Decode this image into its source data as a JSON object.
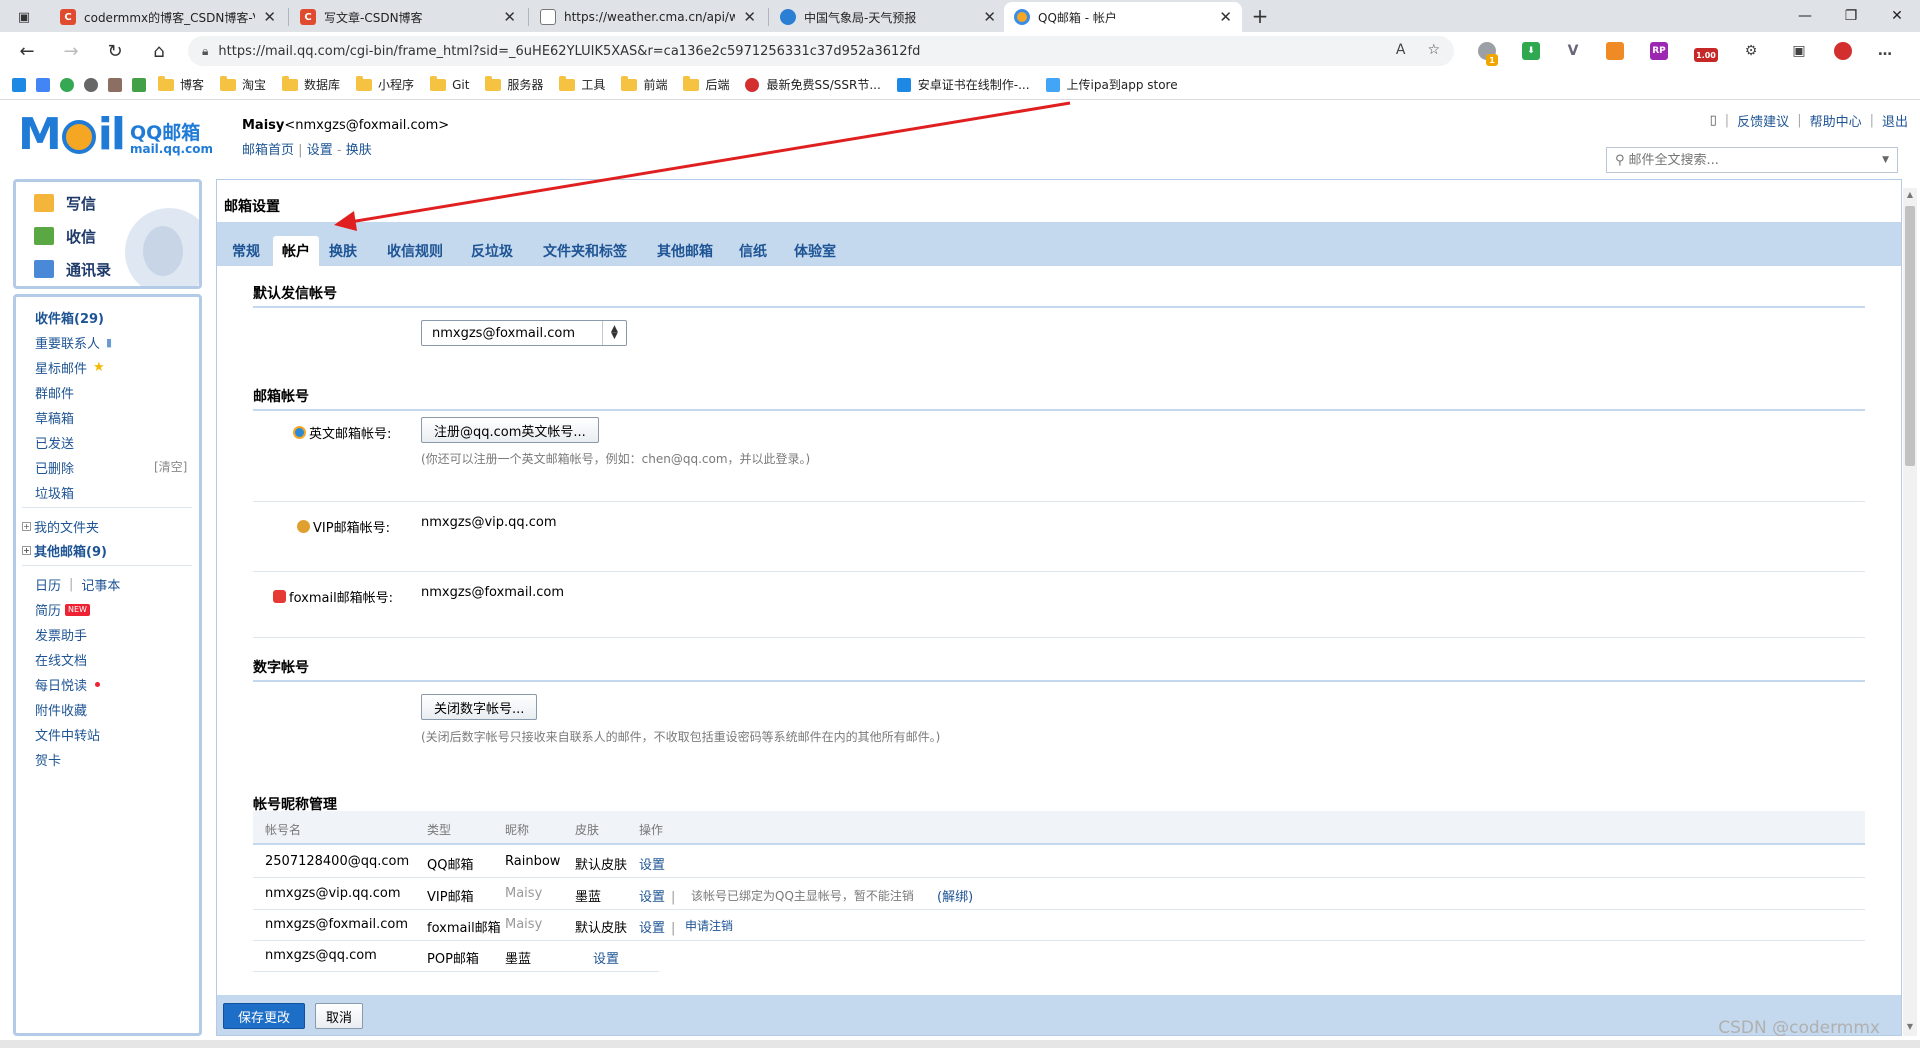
{
  "browser": {
    "tabs": [
      {
        "title": "codermmx的博客_CSDN博客-Vue",
        "icon": "csdn-icon",
        "color": "#e04a2f"
      },
      {
        "title": "写文章-CSDN博客",
        "icon": "csdn-icon",
        "color": "#e04a2f"
      },
      {
        "title": "https://weather.cma.cn/api/weat",
        "icon": "document-icon",
        "color": "#777777"
      },
      {
        "title": "中国气象局-天气预报",
        "icon": "weather-icon",
        "color": "#2a7fd4"
      },
      {
        "title": "QQ邮箱 - 帐户",
        "icon": "qqmail-icon",
        "color": "#f5a623"
      }
    ],
    "new_tab": "+",
    "url": "https://mail.qq.com/cgi-bin/frame_html?sid=_6uHE62YLUIK5XAS&r=ca136e2c5971256331c37d952a3612fd",
    "bookmarks": [
      "博客",
      "淘宝",
      "数据库",
      "小程序",
      "Git",
      "服务器",
      "工具",
      "前端",
      "后端",
      "最新免费SS/SSR节...",
      "安卓证书在线制作-...",
      "上传ipa到app store"
    ],
    "ext_badges": {
      "badge1": "1",
      "badge2": "1.00"
    }
  },
  "mail_header": {
    "logo_mail": "M",
    "logo_il": "il",
    "logo_cn": "QQ邮箱",
    "logo_domain": "mail.qq.com",
    "user_name": "Maisy",
    "user_email": "<nmxgzs@foxmail.com>",
    "links": [
      "邮箱首页",
      "设置",
      "换肤"
    ],
    "top_links": [
      "反馈建议",
      "帮助中心",
      "退出"
    ],
    "search_placeholder": "邮件全文搜索..."
  },
  "sidebar": {
    "quick": [
      "写信",
      "收信",
      "通讯录"
    ],
    "folders": [
      "收件箱(29)",
      "重要联系人",
      "星标邮件",
      "群邮件",
      "草稿箱",
      "已发送",
      "已删除",
      "垃圾箱"
    ],
    "clear_label": "[清空]",
    "my_folders": "我的文件夹",
    "other_mail": "其他邮箱(9)",
    "calendar": "日历",
    "notes": "记事本",
    "apps": [
      "简历",
      "发票助手",
      "在线文档",
      "每日悦读",
      "附件收藏",
      "文件中转站",
      "贺卡"
    ],
    "new_tag": "NEW"
  },
  "settings": {
    "page_title": "邮箱设置",
    "tabs": [
      "常规",
      "帐户",
      "换肤",
      "收信规则",
      "反垃圾",
      "文件夹和标签",
      "其他邮箱",
      "信纸",
      "体验室"
    ],
    "active_tab": "帐户",
    "default_sender_section": "默认发信帐号",
    "default_sender_value": "nmxgzs@foxmail.com",
    "mailbox_section": "邮箱帐号",
    "english_label": "英文邮箱帐号:",
    "english_button": "注册@qq.com英文帐号...",
    "english_hint": "(你还可以注册一个英文邮箱帐号，例如：chen@qq.com，并以此登录。)",
    "vip_label": "VIP邮箱帐号:",
    "vip_value": "nmxgzs@vip.qq.com",
    "foxmail_label": "foxmail邮箱帐号:",
    "foxmail_value": "nmxgzs@foxmail.com",
    "digital_section": "数字帐号",
    "digital_button": "关闭数字帐号...",
    "digital_hint": "(关闭后数字帐号只接收来自联系人的邮件，不收取包括重设密码等系统邮件在内的其他所有邮件。)",
    "nickname_section": "帐号昵称管理",
    "table_headers": [
      "帐号名",
      "类型",
      "昵称",
      "皮肤",
      "操作"
    ],
    "rows": [
      {
        "account": "2507128400@qq.com",
        "type": "QQ邮箱",
        "nickname": "Rainbow",
        "skin": "默认皮肤",
        "op": "设置",
        "extra": ""
      },
      {
        "account": "nmxgzs@vip.qq.com",
        "type": "VIP邮箱",
        "nickname": "Maisy",
        "skin": "墨蓝",
        "op": "设置",
        "extra": "该帐号已绑定为QQ主显帐号，暂不能注销",
        "extra_link": "(解绑)"
      },
      {
        "account": "nmxgzs@foxmail.com",
        "type": "foxmail邮箱",
        "nickname": "Maisy",
        "skin": "默认皮肤",
        "op": "设置",
        "extra": "",
        "extra_link": "申请注销"
      },
      {
        "account": "nmxgzs@qq.com",
        "type": "POP邮箱",
        "nickname": "",
        "skin": "墨蓝",
        "op": "设置",
        "extra": ""
      }
    ],
    "save_button": "保存更改",
    "cancel_button": "取消"
  },
  "watermark": "CSDN @codermmx",
  "colors": {
    "accent": "#1e5494",
    "tab_bar": "#c4d8ee",
    "save_button": "#1c6ec7",
    "arrow": "#e02020"
  }
}
